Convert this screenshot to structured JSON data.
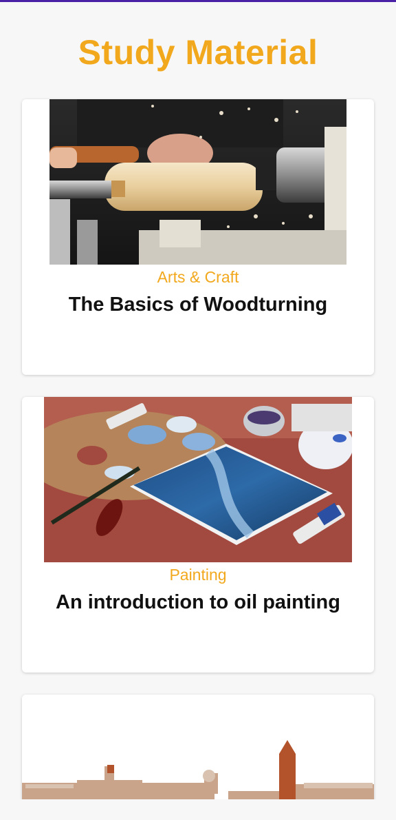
{
  "header": {
    "title": "Study Material",
    "accent_color": "#f2a81d",
    "status_bar_color": "#4a22a8"
  },
  "courses": [
    {
      "category": "Arts & Craft",
      "title": "The Basics of Woodturning",
      "image": "woodturning-lathe-photo"
    },
    {
      "category": "Painting",
      "title": "An introduction to oil painting",
      "image": "oil-painting-palette-photo"
    },
    {
      "category": "",
      "title": "",
      "image": "city-skyline-photo"
    }
  ]
}
